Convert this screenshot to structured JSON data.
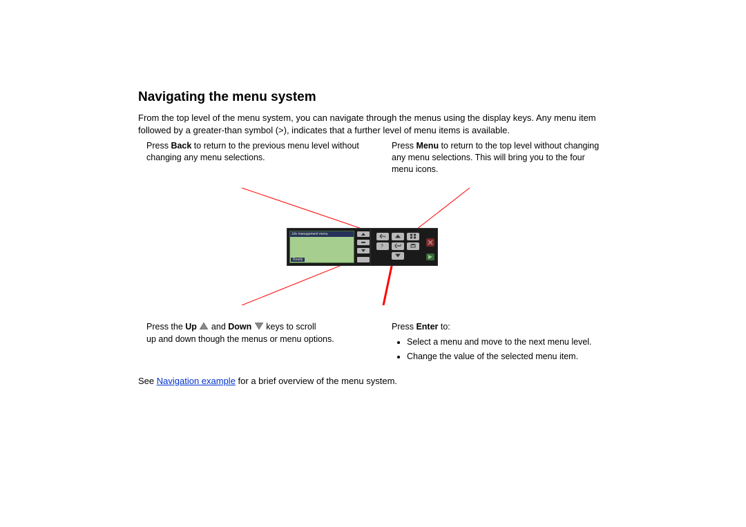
{
  "title": "Navigating the menu system",
  "intro": "From the top level of the menu system, you can navigate through the menus using the display keys. Any menu item followed by a greater-than symbol (>), indicates that a further level of menu items is available.",
  "callout_back_pre": "Press ",
  "callout_back_bold": "Back",
  "callout_back_post": " to return to the previous menu level without changing any menu selections.",
  "callout_menu_pre": "Press ",
  "callout_menu_bold": "Menu",
  "callout_menu_post": " to return to the top level without changing any menu selections. This will bring you to the four menu icons.",
  "callout_updown_pre": "Press the ",
  "callout_updown_up": "Up",
  "callout_updown_mid": " and ",
  "callout_updown_down": "Down",
  "callout_updown_post1": " keys to scroll",
  "callout_updown_line2": "up and down though the menus or menu options.",
  "callout_enter_pre": "Press ",
  "callout_enter_bold": "Enter",
  "callout_enter_post": " to:",
  "enter_bullets": [
    "Select a menu and move to the next menu level.",
    "Change the value of the selected menu item."
  ],
  "footer_pre": "See ",
  "footer_link": "Navigation example",
  "footer_post": " for a brief overview of the menu system.",
  "lcd_title": "Job management menu",
  "lcd_ready": "Ready"
}
